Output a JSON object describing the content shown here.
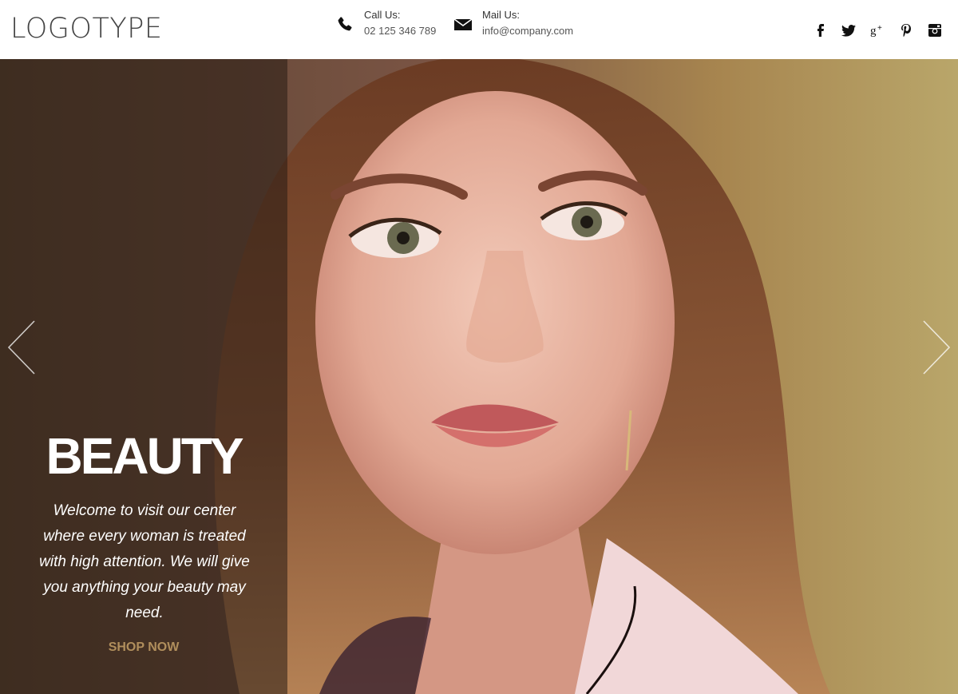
{
  "header": {
    "logo": "LOGOTYPE",
    "call": {
      "label": "Call Us:",
      "value": "02 125 346 789",
      "icon": "phone-icon"
    },
    "mail": {
      "label": "Mail Us:",
      "value": "info@company.com",
      "icon": "envelope-icon"
    },
    "social": [
      {
        "name": "facebook",
        "glyph": "f"
      },
      {
        "name": "twitter",
        "glyph": "t"
      },
      {
        "name": "google-plus",
        "glyph": "g+"
      },
      {
        "name": "pinterest",
        "glyph": "p"
      },
      {
        "name": "instagram",
        "glyph": "ig"
      }
    ]
  },
  "hero": {
    "title": "BEAUTY",
    "text": "Welcome to visit our center where every woman is treated with high attention. We will give you anything your beauty may need.",
    "cta": "SHOP NOW",
    "prev_icon": "chevron-left-icon",
    "next_icon": "chevron-right-icon"
  },
  "colors": {
    "accent": "#b08e5c",
    "panel_overlay": "rgba(40,28,20,0.55)",
    "text_dark": "#444444"
  }
}
